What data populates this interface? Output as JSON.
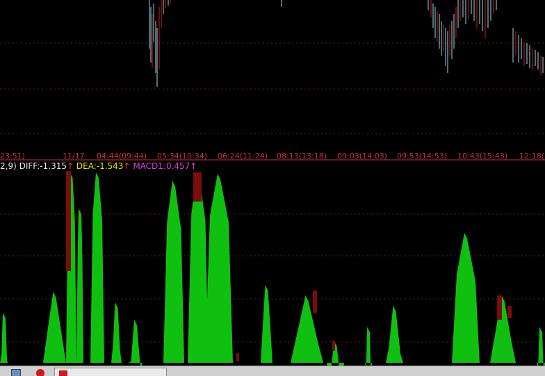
{
  "time_axis": {
    "labels": [
      "23:51)",
      "11/17",
      "04:44(09:44)",
      "05:34(10:34)",
      "06:24(11:24)",
      "08:13(13:18)",
      "09:03(14:03)",
      "09:53(14:53)",
      "10:43(15:43)",
      "12:18(1"
    ]
  },
  "indicator": {
    "params_text": "2,9)",
    "diff_text": "DIFF:-1.315",
    "diff_arrow": "↑",
    "dea_text": "DEA:-1.543",
    "dea_arrow": "↑",
    "macd_text": "MACD1:0.457",
    "macd_arrow": "↑",
    "colors": {
      "diff": "#e6e6e6",
      "dea": "#e6e600",
      "macd": "#e040e0",
      "arrow": "#ff3c3c"
    }
  },
  "colors": {
    "background": "#000000",
    "grid": "#6e1e1e",
    "separator": "#c8323c",
    "bar_up": "#10c010",
    "bar_down": "#7a0c0c",
    "candle_cyan": "#9ad8e6",
    "candle_red": "#c82020"
  },
  "taskbar": {
    "window_title": "",
    "icons": [
      "monitor-icon",
      "red-circle-icon",
      "app-icon"
    ]
  }
}
